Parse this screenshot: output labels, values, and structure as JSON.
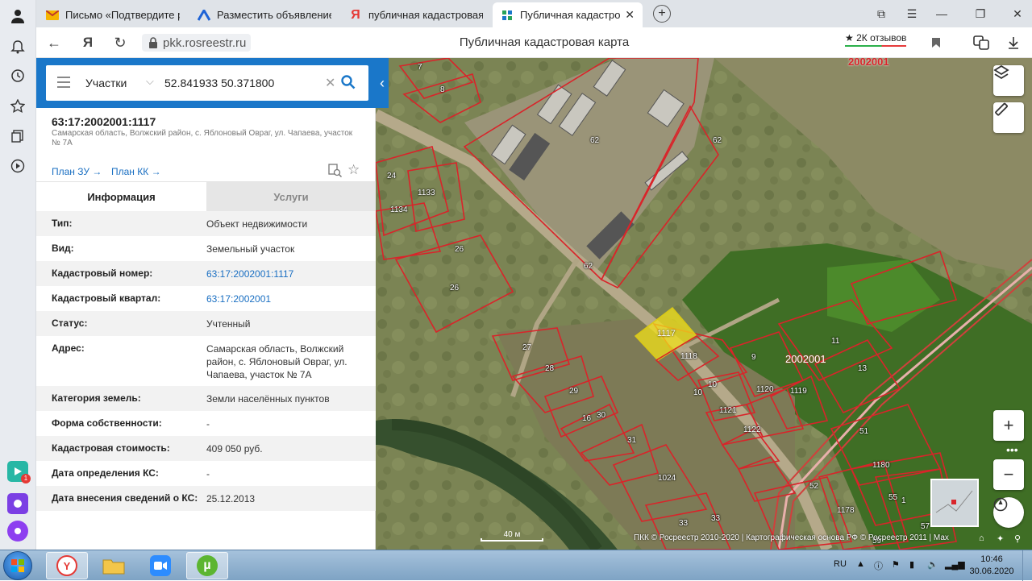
{
  "browser": {
    "tabs": [
      {
        "label": "Письмо «Подтвердите ре",
        "icon": "mail-icon",
        "active": false
      },
      {
        "label": "Разместить объявление о",
        "icon": "ad-icon",
        "active": false
      },
      {
        "label": "публичная кадастровая к",
        "icon": "yandex-icon",
        "active": false
      },
      {
        "label": "Публичная кадастровая",
        "icon": "pkk-icon",
        "active": true
      }
    ],
    "url": "pkk.rosreestr.ru",
    "page_title": "Публичная кадастровая карта",
    "reviews": "2К отзывов"
  },
  "search": {
    "category": "Участки",
    "query": "52.841933 50.371800"
  },
  "object": {
    "number": "63:17:2002001:1117",
    "address": "Самарская область, Волжский район, с. Яблоновый Овраг, ул. Чапаева, участок № 7А",
    "plan_zu": "План ЗУ →",
    "plan_kk": "План КК →"
  },
  "panel_tabs": {
    "info": "Информация",
    "services": "Услуги"
  },
  "rows": [
    {
      "key": "Тип:",
      "value": "Объект недвижимости",
      "link": false
    },
    {
      "key": "Вид:",
      "value": "Земельный участок",
      "link": false
    },
    {
      "key": "Кадастровый номер:",
      "value": "63:17:2002001:1117",
      "link": true
    },
    {
      "key": "Кадастровый квартал:",
      "value": "63:17:2002001",
      "link": true
    },
    {
      "key": "Статус:",
      "value": "Учтенный",
      "link": false
    },
    {
      "key": "Адрес:",
      "value": "Самарская область, Волжский район, с. Яблоновый Овраг, ул. Чапаева, участок № 7А",
      "link": false
    },
    {
      "key": "Категория земель:",
      "value": "Земли населённых пунктов",
      "link": false
    },
    {
      "key": "Форма собственности:",
      "value": "-",
      "link": false
    },
    {
      "key": "Кадастровая стоимость:",
      "value": "409 050 руб.",
      "link": false
    },
    {
      "key": "Дата определения КС:",
      "value": "-",
      "link": false
    },
    {
      "key": "Дата внесения сведений о КС:",
      "value": "25.12.2013",
      "link": false
    }
  ],
  "map": {
    "quarter_label_top": "2002001",
    "quarter_label_mid": "2002001",
    "selected_parcel": "1117",
    "parcel_labels": [
      "7",
      "8",
      "62",
      "62",
      "62",
      "24",
      "1133",
      "1134",
      "26",
      "26",
      "1118",
      "27",
      "28",
      "29",
      "16",
      "30",
      "31",
      "1024",
      "33",
      "33",
      "9",
      "11",
      "13",
      "10",
      "10",
      "1121",
      "1120",
      "1119",
      "1122",
      "51",
      "1180",
      "52",
      "55",
      "1",
      "1178",
      "57",
      "59"
    ],
    "scale": "40 м",
    "attribution": "ПКК © Росреестр 2010-2020 | Картографическая основа РФ © Росреестр 2011 | Мах"
  },
  "taskbar": {
    "lang": "RU",
    "time": "10:46",
    "date": "30.06.2020"
  },
  "colors": {
    "brand_blue": "#1a77c9",
    "parcel_red": "#d9242a",
    "selected_yellow": "#f2e21a"
  }
}
